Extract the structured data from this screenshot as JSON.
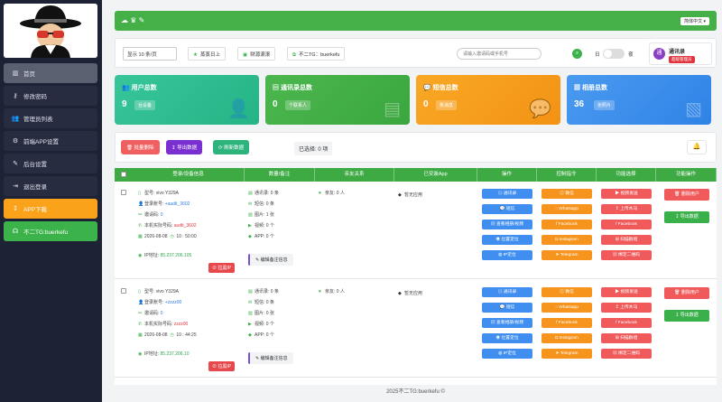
{
  "sidebar": {
    "logo_alt": "agent avatar",
    "items": [
      {
        "label": "首页",
        "icon": "bar-chart-icon"
      },
      {
        "label": "修改密码",
        "icon": "key-icon"
      },
      {
        "label": "管理员列表",
        "icon": "users-icon"
      },
      {
        "label": "前端APP设置",
        "icon": "gear-icon"
      },
      {
        "label": "后台设置",
        "icon": "wrench-icon"
      },
      {
        "label": "退出登录",
        "icon": "logout-icon"
      },
      {
        "label": "APP下载",
        "icon": "download-icon"
      },
      {
        "label": "不二TG:buerkefu",
        "icon": "headset-icon"
      }
    ]
  },
  "topbar": {
    "lang": "简体中文 ▾"
  },
  "toolbar": {
    "page_size": "显示 10 条/页",
    "btn1": "蒸蒸日上",
    "btn2": "财源滚滚",
    "btn3": "不二TG：buerkefu",
    "search_placeholder": "请输入邀请码或手机号",
    "toggle_left": "日",
    "toggle_right": "夜",
    "user_name": "通讯录",
    "user_role": "超级管理员"
  },
  "stats": [
    {
      "title": "用户总数",
      "value": "9",
      "badge": "台设备"
    },
    {
      "title": "通讯录总数",
      "value": "0",
      "badge": "个联系人"
    },
    {
      "title": "短信总数",
      "value": "0",
      "badge": "条消息"
    },
    {
      "title": "相册总数",
      "value": "36",
      "badge": "张照片"
    }
  ],
  "actions": {
    "delete": "批量删除",
    "export": "导出数据",
    "refresh": "刷新数据",
    "selected": "已选择: 0 项"
  },
  "table": {
    "headers": [
      "登录/设备信息",
      "数量/备注",
      "亲友关系",
      "已安装App",
      "操作",
      "控制指令",
      "功能选择",
      "功能操作"
    ],
    "rows": [
      {
        "model": "型号: vivo Y329A",
        "login_label": "登录账号:",
        "login_value": "+audit_3602",
        "invite_label": "邀请码:",
        "invite_value": "0",
        "phone_label": "本机实际号码:",
        "phone_value": "audit_3602",
        "date": "2026-08-08",
        "time": "10 : 50:00",
        "ip_label": "IP地址:",
        "ip_value": "85.237.206.105",
        "ip_btn": "拉黑IP",
        "contacts": "通讯录: 0 条",
        "sms": "短信: 0 条",
        "photos": "图片: 1 张",
        "videos": "视频: 0 个",
        "apps": "APP: 0 个",
        "remark": "编辑备注信息",
        "friends": "亲友: 0 人",
        "installed": "暂无应用"
      },
      {
        "model": "型号: vivo Y329A",
        "login_label": "登录账号:",
        "login_value": "+zzzz00",
        "invite_label": "邀请码:",
        "invite_value": "0",
        "phone_label": "本机实际号码:",
        "phone_value": "zzzz00",
        "date": "2026-08-08",
        "time": "10 : 44:25",
        "ip_label": "IP地址:",
        "ip_value": "85.237.206.10",
        "ip_btn": "拉黑IP",
        "contacts": "通讯录: 0 条",
        "sms": "短信: 0 条",
        "photos": "图片: 0 张",
        "videos": "视频: 0 个",
        "apps": "APP: 0 个",
        "remark": "编辑备注信息",
        "friends": "亲友: 0 人",
        "installed": "暂无应用"
      }
    ],
    "op_buttons": [
      "通讯录",
      "短信",
      "查看相册/视频",
      "位置定位",
      "IP定位"
    ],
    "ctrl_buttons": [
      "微信",
      "Whatsapp",
      "Facebook",
      "Instagram",
      "Telegram"
    ],
    "func_buttons": [
      "视频发送",
      "上传木马",
      "Facebook",
      "扫描群组",
      "绑定二维码"
    ],
    "func_ops": [
      "删除用户",
      "导出数据"
    ]
  },
  "footer": "2025不二TG:buerkefu ©"
}
